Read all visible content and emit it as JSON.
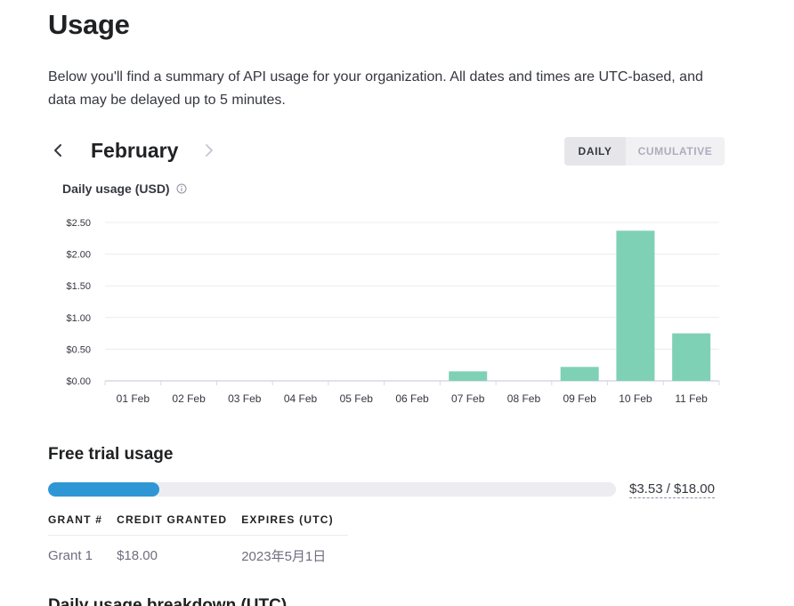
{
  "page": {
    "title": "Usage",
    "intro": "Below you'll find a summary of API usage for your organization. All dates and times are UTC-based, and data may be delayed up to 5 minutes."
  },
  "nav": {
    "month": "February",
    "prev_icon": "chevron-left-icon",
    "next_icon": "chevron-right-icon"
  },
  "toggle": {
    "daily": "DAILY",
    "cumulative": "CUMULATIVE",
    "active": "daily"
  },
  "chart_title": "Daily usage (USD)",
  "chart_data": {
    "type": "bar",
    "categories": [
      "01 Feb",
      "02 Feb",
      "03 Feb",
      "04 Feb",
      "05 Feb",
      "06 Feb",
      "07 Feb",
      "08 Feb",
      "09 Feb",
      "10 Feb",
      "11 Feb"
    ],
    "values": [
      0,
      0,
      0,
      0,
      0,
      0,
      0.15,
      0,
      0.22,
      2.37,
      0.75
    ],
    "yticks": [
      "$0.00",
      "$0.50",
      "$1.00",
      "$1.50",
      "$2.00",
      "$2.50"
    ],
    "ylim": [
      0,
      2.5
    ],
    "grid": true,
    "bar_color": "#7fd1b5"
  },
  "free_trial": {
    "title": "Free trial usage",
    "used_fraction": 0.196,
    "amount_text": "$3.53 / $18.00",
    "bar_color": "#2f96d6"
  },
  "grants": {
    "headers": [
      "GRANT #",
      "CREDIT GRANTED",
      "EXPIRES (UTC)"
    ],
    "rows": [
      [
        "Grant 1",
        "$18.00",
        "2023年5月1日"
      ]
    ]
  },
  "next_section_title": "Daily usage breakdown (UTC)"
}
